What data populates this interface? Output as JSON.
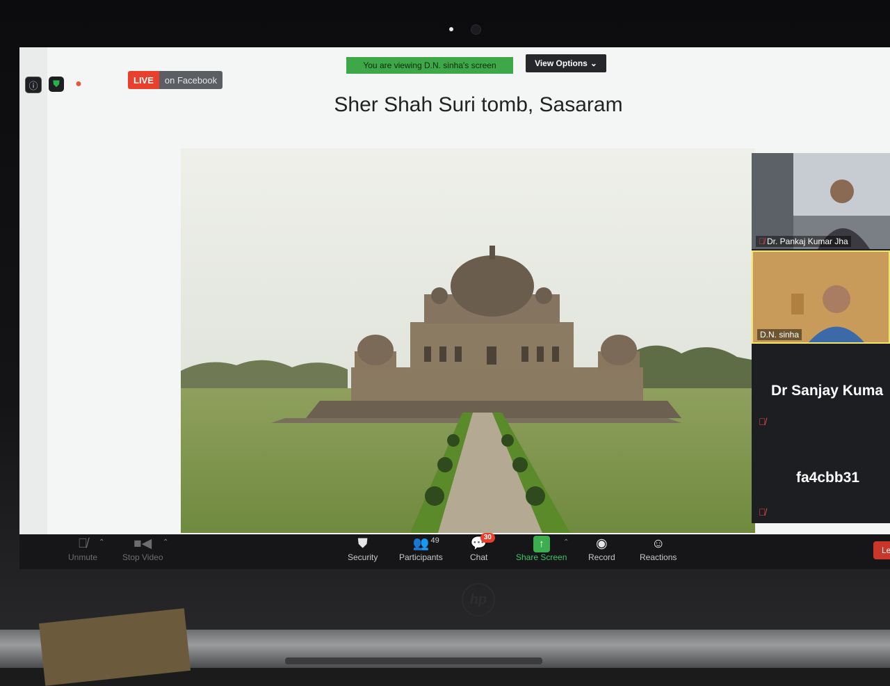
{
  "meeting": {
    "live_label": "LIVE",
    "live_platform": "on Facebook",
    "viewing_banner": "You are viewing D.N. sinha's screen",
    "view_options_label": "View Options",
    "slide_title": "Sher Shah Suri tomb, Sasaram"
  },
  "participants_panel": {
    "tiles": [
      {
        "name": "Dr. Pankaj Kumar Jha",
        "muted": true
      },
      {
        "name": "D.N. sinha",
        "muted": false
      }
    ],
    "audio_only": [
      {
        "name": "Dr Sanjay Kuma",
        "muted": true
      },
      {
        "name": "fa4cbb31",
        "muted": true
      }
    ]
  },
  "toolbar": {
    "unmute": "Unmute",
    "stop_video": "Stop Video",
    "security": "Security",
    "participants": "Participants",
    "participants_count": "49",
    "chat": "Chat",
    "chat_badge": "30",
    "share_screen": "Share Screen",
    "record": "Record",
    "reactions": "Reactions",
    "leave": "Le"
  },
  "colors": {
    "live_red": "#e8402d",
    "share_green": "#3cae4f",
    "banner_green": "#3ea848",
    "active_speaker_border": "#f2e56b"
  }
}
